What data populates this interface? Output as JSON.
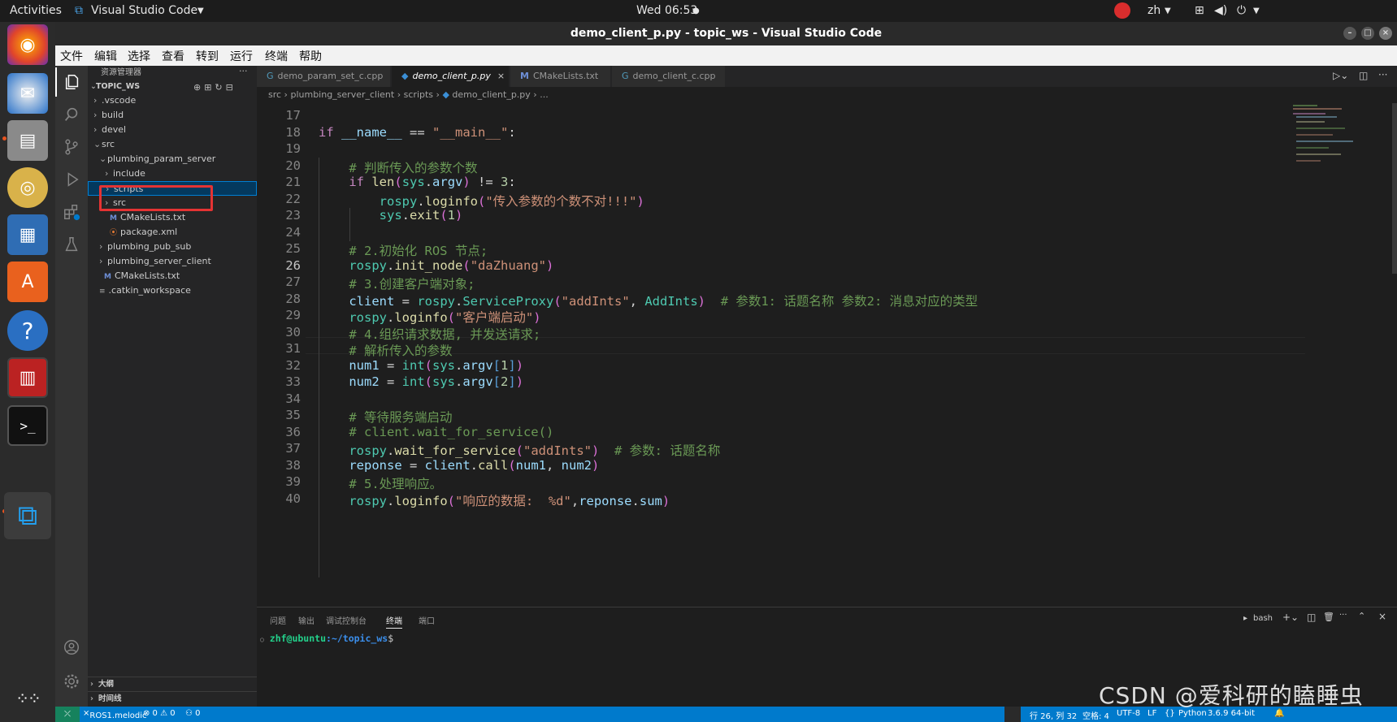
{
  "topbar": {
    "activities": "Activities",
    "app": "Visual Studio Code",
    "clock": "Wed 06:53",
    "lang": "zh"
  },
  "window": {
    "title": "demo_client_p.py - topic_ws - Visual Studio Code"
  },
  "menu": [
    "文件",
    "编辑",
    "选择",
    "查看",
    "转到",
    "运行",
    "终端",
    "帮助"
  ],
  "explorer": {
    "header": "资源管理器",
    "workspace": "TOPIC_WS",
    "items": [
      ".vscode",
      "build",
      "devel",
      "src",
      "plumbing_param_server",
      "include",
      "scripts",
      "src",
      "CMakeLists.txt",
      "package.xml",
      "plumbing_pub_sub",
      "plumbing_server_client",
      "CMakeLists.txt",
      ".catkin_workspace"
    ],
    "outline": "大纲",
    "timeline": "时间线"
  },
  "tabs": [
    "demo_param_set_c.cpp",
    "demo_client_p.py",
    "CMakeLists.txt",
    "demo_client_c.cpp"
  ],
  "breadcrumb": [
    "src",
    "plumbing_server_client",
    "scripts",
    "demo_client_p.py",
    "..."
  ],
  "code_lines": [
    "17",
    "18",
    "19",
    "20",
    "21",
    "22",
    "23",
    "24",
    "25",
    "26",
    "27",
    "28",
    "29",
    "30",
    "31",
    "32",
    "33",
    "34",
    "35",
    "36",
    "37",
    "38",
    "39",
    "40"
  ],
  "code_text": {
    "l20": "# 判断传入的参数个数",
    "l22s": "\"传入参数的个数不对!!!\"",
    "l25": "# 2.初始化 ROS 节点;",
    "l26s": "\"daZhuang\"",
    "l27": "# 3.创建客户端对象;",
    "l28s": "\"addInts\"",
    "l28c": "# 参数1: 话题名称 参数2: 消息对应的类型",
    "l29s": "\"客户端启动\"",
    "l30": "# 4.组织请求数据, 并发送请求;",
    "l31": "# 解析传入的参数",
    "l35": "# 等待服务端启动",
    "l36": "# client.wait_for_service()",
    "l37s": "\"addInts\"",
    "l37c": "# 参数: 话题名称",
    "l39": "# 5.处理响应。",
    "l40s": "\"响应的数据:  %d\""
  },
  "panel": {
    "tabs": [
      "问题",
      "输出",
      "调试控制台",
      "终端",
      "端口"
    ],
    "shell": "bash",
    "prompt_user": "zhf@ubuntu",
    "prompt_path": ":~/topic_ws",
    "prompt_end": "$"
  },
  "status": {
    "remote": "ROS1.melodic",
    "problems": "⊗ 0 ⚠ 0",
    "ports": "⚇ 0",
    "position": "行 26, 列 32",
    "spaces": "空格: 4",
    "encoding": "UTF-8",
    "eol": "LF",
    "lang": "Python",
    "version": "3.6.9 64-bit"
  },
  "watermark": "CSDN @爱科研的瞌睡虫",
  "colors": {
    "accent": "#007acc",
    "highlight_box": "#e53333"
  }
}
